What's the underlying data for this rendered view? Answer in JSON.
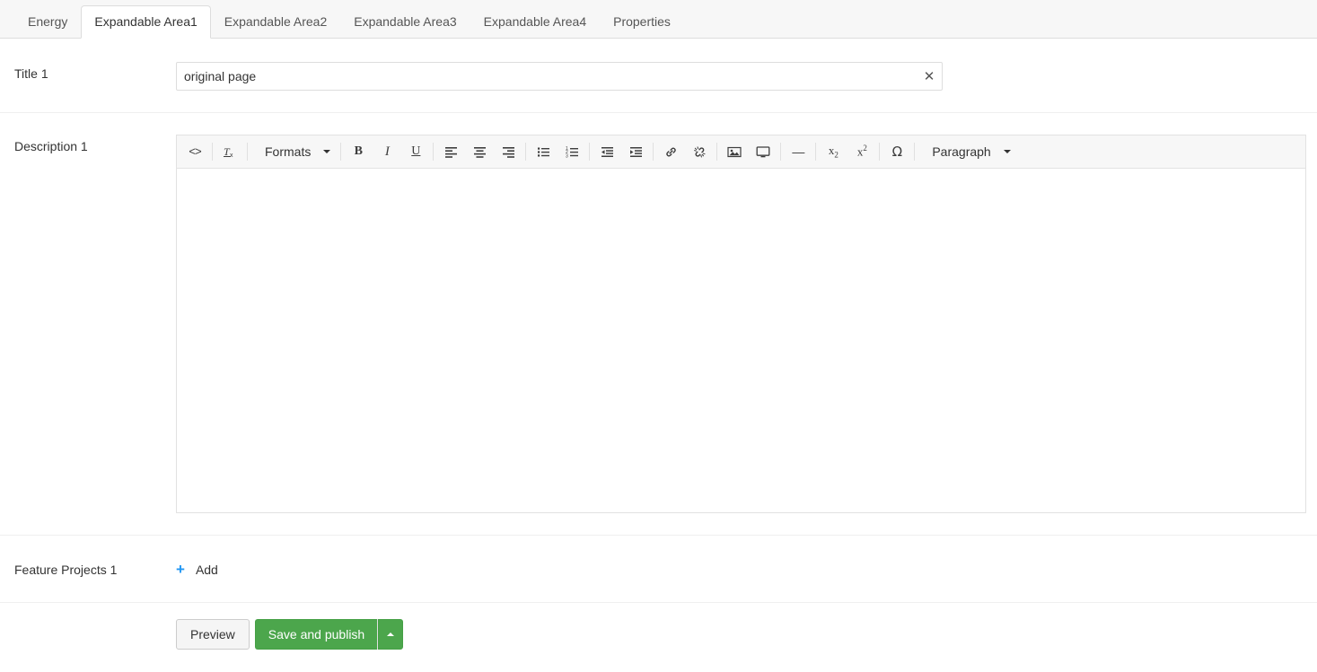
{
  "tabs": [
    {
      "label": "Energy",
      "active": false
    },
    {
      "label": "Expandable Area1",
      "active": true
    },
    {
      "label": "Expandable Area2",
      "active": false
    },
    {
      "label": "Expandable Area3",
      "active": false
    },
    {
      "label": "Expandable Area4",
      "active": false
    },
    {
      "label": "Properties",
      "active": false
    }
  ],
  "form": {
    "title_field": {
      "label": "Title 1",
      "value": "original page",
      "placeholder": "",
      "clear_icon": "close-icon"
    },
    "description_field": {
      "label": "Description 1",
      "content": "",
      "toolbar": {
        "source_code": "<>",
        "remove_format": "Tx",
        "formats_label": "Formats",
        "bold": "B",
        "italic": "I",
        "underline": "U",
        "align_left": "align-left-icon",
        "align_center": "align-center-icon",
        "align_right": "align-right-icon",
        "bullet_list": "bullet-list-icon",
        "numbered_list": "numbered-list-icon",
        "outdent": "outdent-icon",
        "indent": "indent-icon",
        "link": "link-icon",
        "unlink": "unlink-icon",
        "image": "image-icon",
        "media": "media-icon",
        "horizontal_rule": "—",
        "subscript": "x",
        "subscript_mark": "2",
        "superscript": "x",
        "superscript_mark": "2",
        "special_char": "Ω",
        "paragraph_label": "Paragraph"
      }
    },
    "feature_projects": {
      "label": "Feature Projects 1",
      "add_label": "Add",
      "add_icon": "plus-icon"
    }
  },
  "actions": {
    "preview_label": "Preview",
    "save_label": "Save and publish",
    "dropdown_icon": "caret-up-icon"
  },
  "colors": {
    "primary": "#4ca64c",
    "accent": "#2196f3",
    "tabbar_bg": "#f7f7f7",
    "border": "#dddddd"
  }
}
